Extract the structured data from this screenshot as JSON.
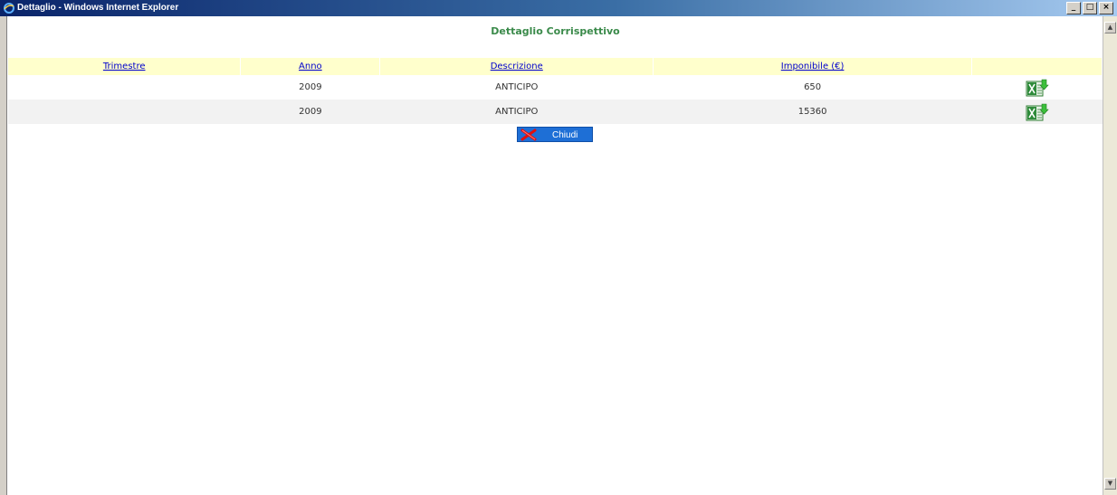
{
  "window": {
    "title": "Dettaglio - Windows Internet Explorer",
    "minimize": "_",
    "maximize": "□",
    "close": "×"
  },
  "page": {
    "title": "Dettaglio Corrispettivo"
  },
  "table": {
    "headers": [
      "Trimestre",
      "Anno",
      "Descrizione",
      "Imponibile (€)"
    ],
    "rows": [
      {
        "trimestre": "",
        "anno": "2009",
        "descrizione": "ANTICIPO",
        "imponibile": "650",
        "export_icon": "excel-export-icon"
      },
      {
        "trimestre": "",
        "anno": "2009",
        "descrizione": "ANTICIPO",
        "imponibile": "15360",
        "export_icon": "excel-export-icon"
      }
    ]
  },
  "close_button": {
    "label": "Chiudi",
    "icon": "red-x-icon"
  },
  "colors": {
    "title_green": "#3a8a4a",
    "header_bg": "#ffffcc",
    "link_blue": "#0000cc",
    "button_blue": "#1e6fd6"
  }
}
